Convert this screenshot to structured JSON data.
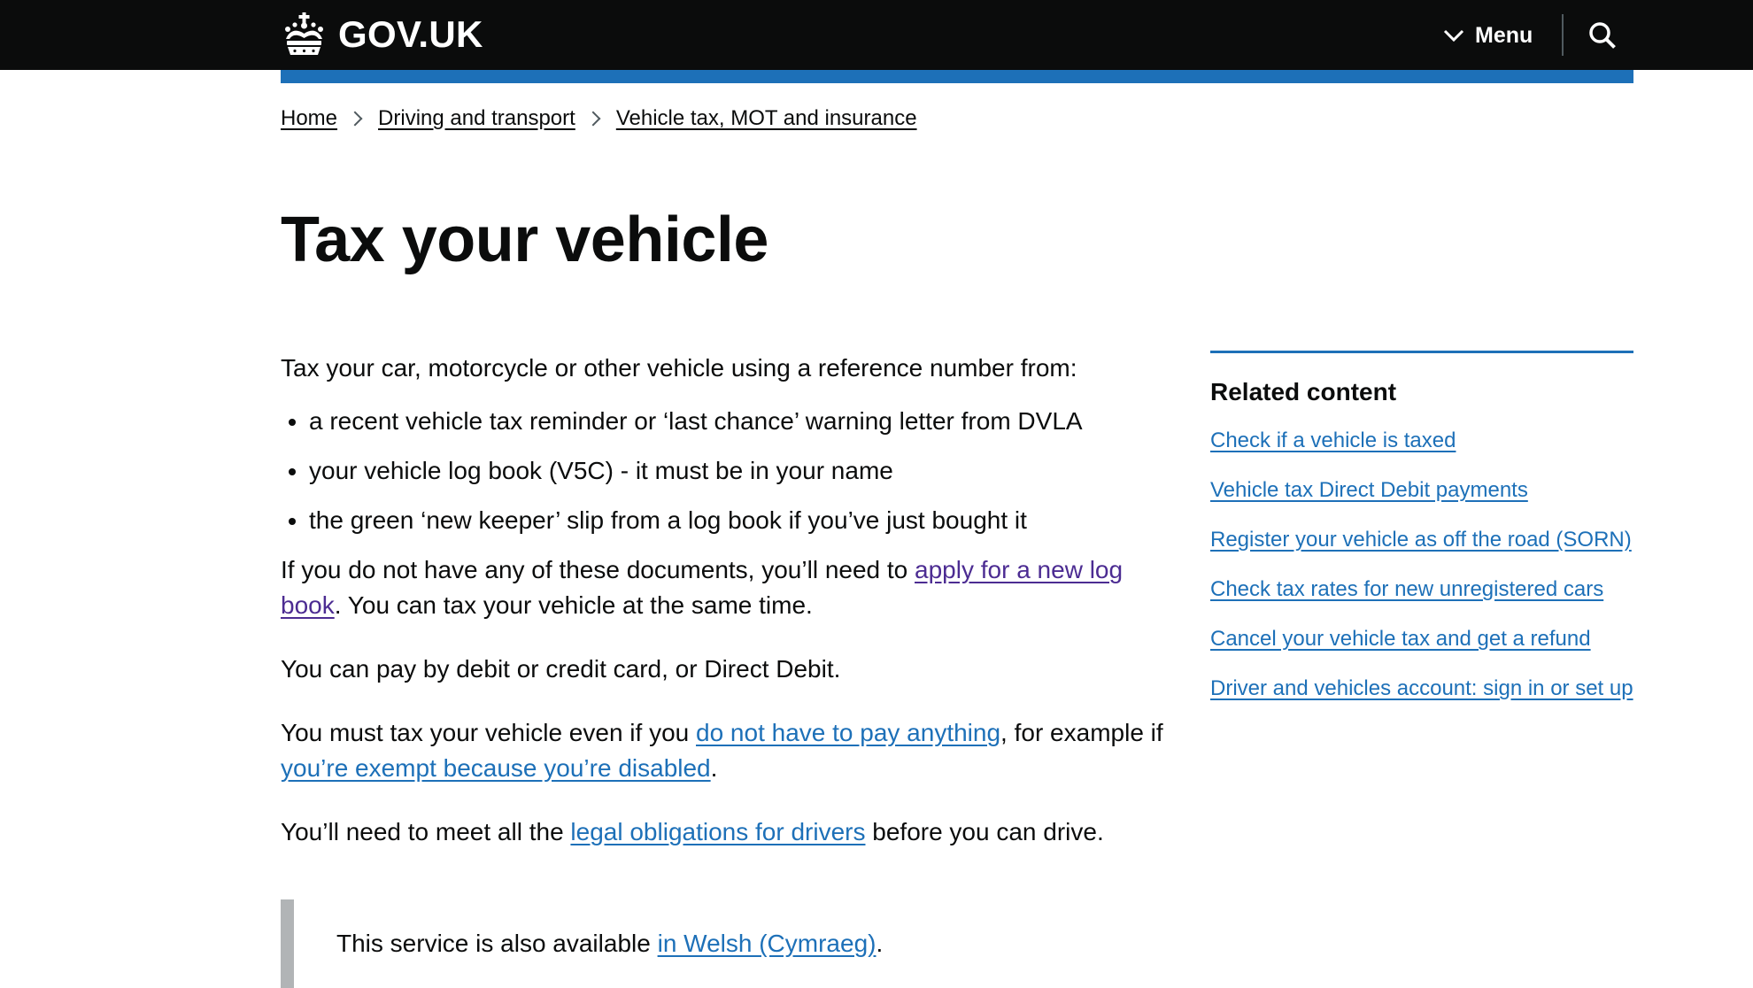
{
  "header": {
    "logo_text": "GOV.UK",
    "menu_label": "Menu",
    "search_label": "Search GOV.UK"
  },
  "breadcrumbs": [
    {
      "label": "Home"
    },
    {
      "label": "Driving and transport"
    },
    {
      "label": "Vehicle tax, MOT and insurance"
    }
  ],
  "page": {
    "title": "Tax your vehicle"
  },
  "content": {
    "intro": "Tax your car, motorcycle or other vehicle using a reference number from:",
    "bullets": [
      "a recent vehicle tax reminder or ‘last chance’ warning letter from DVLA",
      "your vehicle log book (V5C) - it must be in your name",
      "the green ‘new keeper’ slip from a log book if you’ve just bought it"
    ],
    "para_no_docs": {
      "before": "If you do not have any of these documents, you’ll need to ",
      "link": "apply for a new log book",
      "after": ". You can tax your vehicle at the same time."
    },
    "para_pay": "You can pay by debit or credit card, or Direct Debit.",
    "para_must": {
      "before": "You must tax your vehicle even if you ",
      "link1": "do not have to pay anything",
      "middle": ", for example if ",
      "link2": "you’re exempt because you’re disabled",
      "after": "."
    },
    "para_legal": {
      "before": "You’ll need to meet all the ",
      "link": "legal obligations for drivers",
      "after": " before you can drive."
    },
    "inset": {
      "before": "This service is also available ",
      "link": "in Welsh (Cymraeg)",
      "after": "."
    }
  },
  "related": {
    "title": "Related content",
    "links": [
      "Check if a vehicle is taxed",
      "Vehicle tax Direct Debit payments",
      "Register your vehicle as off the road (SORN)",
      "Check tax rates for new unregistered cars",
      "Cancel your vehicle tax and get a refund",
      "Driver and vehicles account: sign in or set up"
    ]
  },
  "colors": {
    "header_bg": "#0b0c0c",
    "accent_blue": "#1d70b8",
    "link": "#1d70b8",
    "visited_link": "#4c2c92",
    "text": "#0b0c0c",
    "inset_border": "#b1b4b6"
  }
}
